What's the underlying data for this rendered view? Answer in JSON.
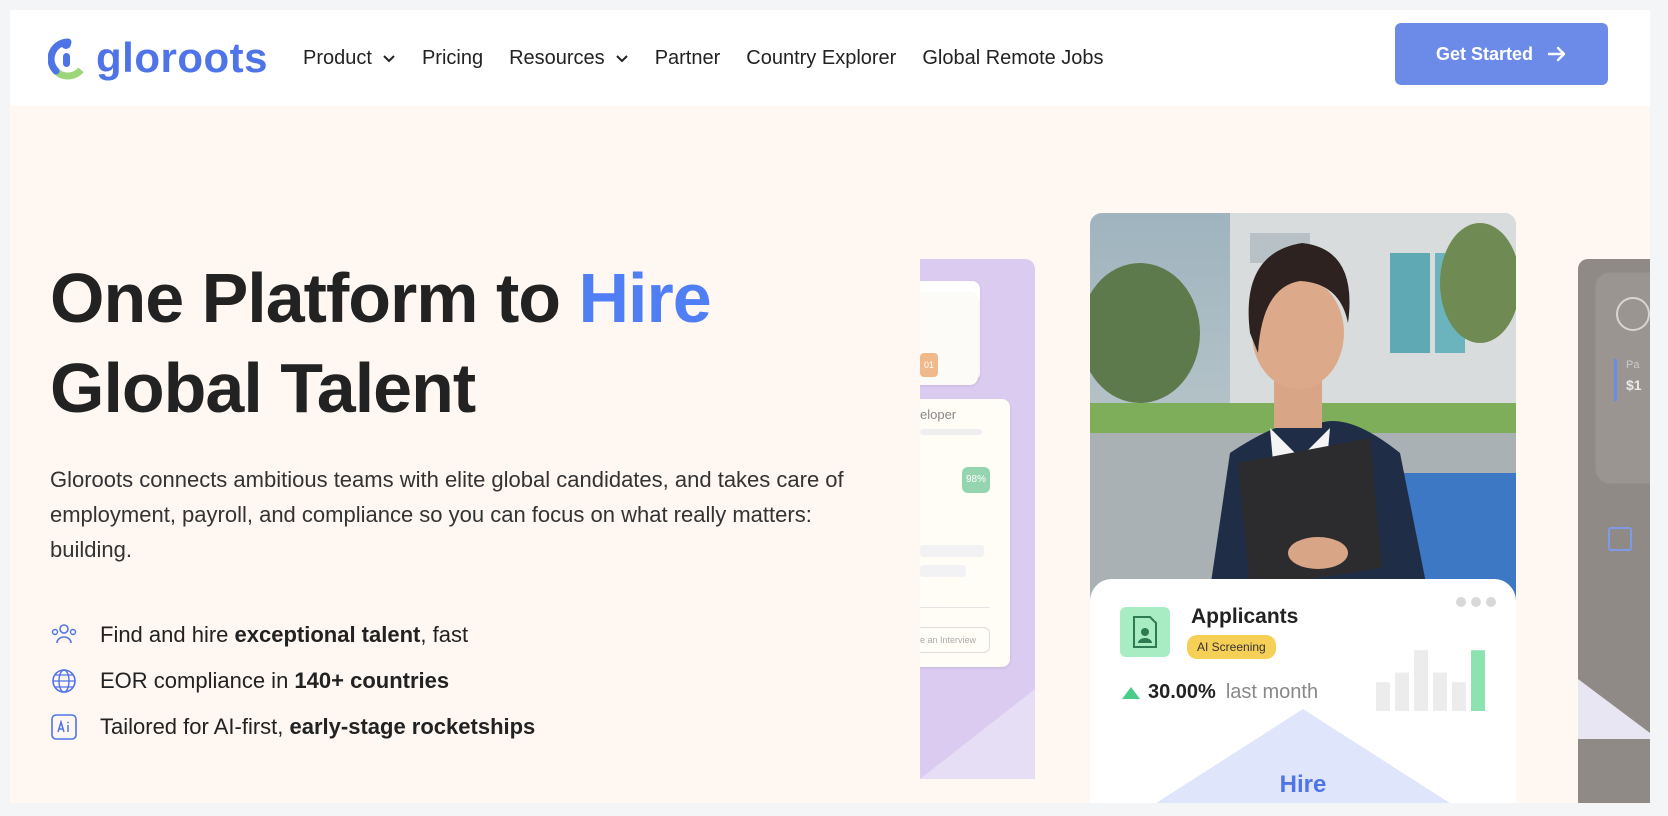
{
  "header": {
    "logo_text": "gloroots",
    "nav": [
      {
        "label": "Product",
        "dropdown": true
      },
      {
        "label": "Pricing",
        "dropdown": false
      },
      {
        "label": "Resources",
        "dropdown": true
      },
      {
        "label": "Partner",
        "dropdown": false
      },
      {
        "label": "Country Explorer",
        "dropdown": false
      },
      {
        "label": "Global Remote Jobs",
        "dropdown": false
      }
    ],
    "cta_label": "Get Started"
  },
  "hero": {
    "title_part1": "One Platform to ",
    "title_accent": "Hire",
    "title_line2": "Global Talent",
    "description": "Gloroots connects ambitious teams with elite global candidates, and takes care of employment, payroll, and compliance so you can focus on what really matters: building.",
    "features": [
      {
        "icon": "people-icon",
        "text_before": "Find and hire ",
        "bold": "exceptional talent",
        "text_after": ", fast"
      },
      {
        "icon": "globe-icon",
        "text_before": "EOR compliance in ",
        "bold": "140+ countries",
        "text_after": ""
      },
      {
        "icon": "ai-icon",
        "text_before": "Tailored for AI-first, ",
        "bold": "early-stage rocketships",
        "text_after": ""
      }
    ]
  },
  "carousel": {
    "left_card": {
      "role_fragment": "eloper",
      "score": "98%",
      "badge": "01",
      "button_fragment": "e an Interview"
    },
    "main_card": {
      "title": "Applicants",
      "badge": "AI Screening",
      "stat_value": "30.00%",
      "stat_label": "last month",
      "bars": [
        0.45,
        0.6,
        0.95,
        0.6,
        0.45,
        0.95
      ],
      "footer_label": "Hire"
    },
    "right_card": {
      "text1": "Pa",
      "text2": "$1"
    }
  },
  "colors": {
    "brand_blue": "#4f74e8",
    "cta_blue": "#6c8be8",
    "accent_blue": "#4f7ef5",
    "hero_bg": "#fff7f1",
    "badge_yellow": "#f6cf56",
    "growth_green": "#4ccc8a"
  }
}
